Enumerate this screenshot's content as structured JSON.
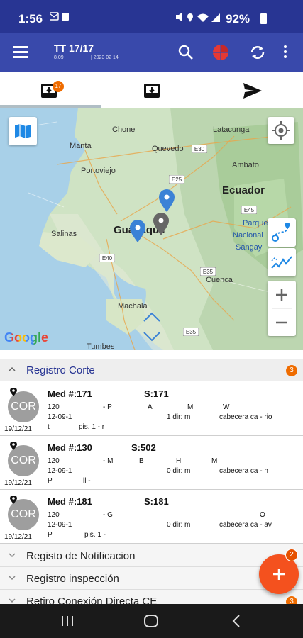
{
  "status_bar": {
    "time": "1:56",
    "battery": "92%",
    "icons": [
      "mail-icon",
      "photo-icon",
      "sim-icon",
      "mute-icon",
      "location-icon",
      "wifi-icon",
      "signal-icon",
      "battery-icon"
    ]
  },
  "app_bar": {
    "title": "TT 17/17",
    "subtitle_left": "8.09",
    "subtitle_right": "| 2023 02 14",
    "actions": [
      "search-icon",
      "pie-chart-icon",
      "sync-icon",
      "more-vert-icon"
    ],
    "accent_color": "#3949ab",
    "status_color": "#283593"
  },
  "tabs": [
    {
      "name": "inbox",
      "icon": "inbox-icon",
      "badge": "17",
      "selected": true
    },
    {
      "name": "inbox-empty",
      "icon": "inbox-icon",
      "badge": "",
      "selected": false
    },
    {
      "name": "send",
      "icon": "send-icon",
      "badge": "",
      "selected": false
    }
  ],
  "map": {
    "labels": {
      "mante": "Manta",
      "chone": "Chone",
      "latacunga": "Latacunga",
      "quevedo": "Quevedo",
      "portoviejo": "Portoviejo",
      "ambato": "Ambato",
      "ecuador": "Ecuador",
      "salinas": "Salinas",
      "guayaquil": "Guayaquil",
      "parque": "Parque",
      "nacional": "Nacional",
      "sangay": "Sangay",
      "cuenca": "Cuenca",
      "machala": "Machala",
      "tumbes": "Tumbes",
      "google": "Google",
      "shield_e30": "E30",
      "shield_e25": "E25",
      "shield_e35": "E35",
      "shield_e45": "E45",
      "shield_e40": "E40",
      "shield_e35b": "E35"
    },
    "controls": [
      "map-layers-icon",
      "my-location-icon",
      "route-icon",
      "track-icon",
      "zoom-in-icon",
      "zoom-out-icon"
    ]
  },
  "list": {
    "groups": [
      {
        "label": "Registro Corte",
        "badge": "3",
        "expanded": true
      },
      {
        "label": "Registo de Notificacion",
        "badge": "",
        "expanded": false
      },
      {
        "label": "Registro inspección",
        "badge": "",
        "expanded": false
      },
      {
        "label": "Retiro Conexión Directa CE",
        "badge": "3",
        "expanded": false
      }
    ],
    "items": [
      {
        "avatar": "COR",
        "med": "Med #:171",
        "s": "S:171",
        "l2a": "120",
        "l2b": "- P",
        "l2c": "A",
        "l2d": "M",
        "l2e": "W",
        "l3a": "12-09-1",
        "l3b": "1 dir: m",
        "l3c": "cabecera  ca - rio",
        "l4a": "t",
        "l4b": "pis. 1 - r",
        "date": "19/12/21"
      },
      {
        "avatar": "COR",
        "med": "Med #:130",
        "s": "S:502",
        "l2a": "120",
        "l2b": "- M",
        "l2c": "B",
        "l2d": "H",
        "l2e": "M",
        "l3a": "12-09-1",
        "l3b": "0 dir: m",
        "l3c": "cabecera  ca - n",
        "l4a": "P",
        "l4b": "ll      -",
        "date": "19/12/21"
      },
      {
        "avatar": "COR",
        "med": "Med #:181",
        "s": "S:181",
        "l2a": "120",
        "l2b": "- G",
        "l2c": "",
        "l2d": "",
        "l2e": "O",
        "l3a": "12-09-1",
        "l3b": "0 dir: m",
        "l3c": "cabecera  ca - av",
        "l4a": "P",
        "l4b": "pis. 1 -",
        "date": "19/12/21"
      }
    ]
  },
  "fab": {
    "icon": "plus-icon",
    "badge": "2",
    "color": "#f4511e"
  },
  "nav": [
    "recents-icon",
    "home-icon",
    "back-icon"
  ]
}
